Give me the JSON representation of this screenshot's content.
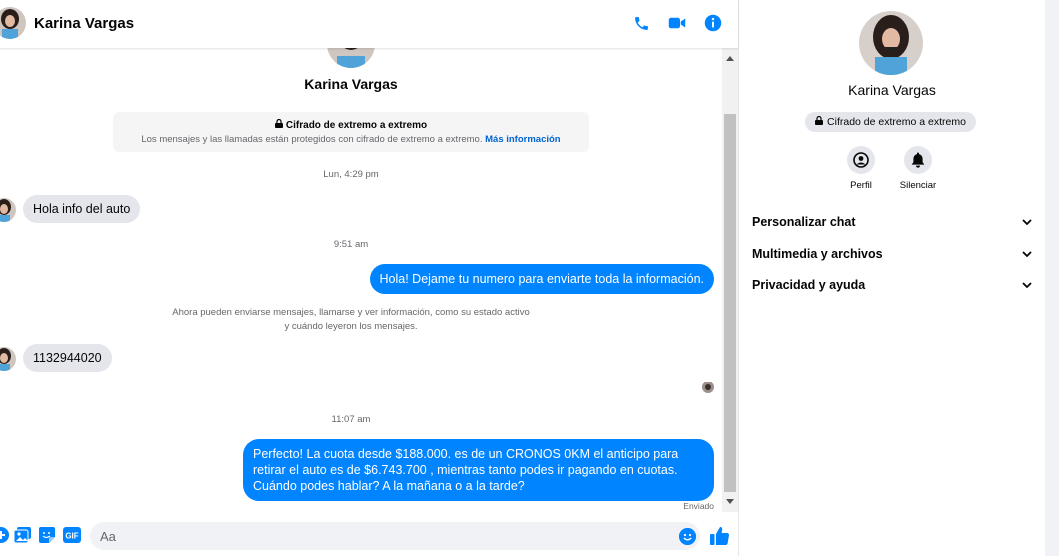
{
  "colors": {
    "accent": "#0084ff",
    "bubble_in": "#e4e6eb",
    "muted_text": "#65676b",
    "link": "#0064d1"
  },
  "header": {
    "contact_name": "Karina Vargas",
    "actions": [
      "phone-icon",
      "video-camera-icon",
      "info-icon"
    ]
  },
  "conversation": {
    "contact_name": "Karina Vargas",
    "e2e_notice": {
      "title": "Cifrado de extremo a extremo",
      "description": "Los mensajes y las llamadas están protegidos con cifrado de extremo a extremo.",
      "link_text": "Más información"
    },
    "timestamps": [
      "Lun, 4:29 pm",
      "9:51 am",
      "11:07 am"
    ],
    "messages": [
      {
        "direction": "in",
        "text": "Hola info del auto"
      },
      {
        "direction": "out",
        "text": "Hola! Dejame tu numero  para enviarte toda la información."
      },
      {
        "direction": "in",
        "text": "1132944020"
      },
      {
        "direction": "out",
        "text": "Perfecto! La cuota desde $188.000. es de un CRONOS 0KM el anticipo para retirar el auto es de $6.743.700 , mientras tanto podes ir pagando en cuotas. Cuándo podes hablar? A la mañana o a la tarde?"
      }
    ],
    "system_note": "Ahora pueden enviarse mensajes, llamarse y ver información, como su estado activo y cuándo leyeron los mensajes.",
    "delivery_status": "Enviado"
  },
  "composer": {
    "placeholder": "Aa",
    "icons": [
      "plus-circle-icon",
      "photo-icon",
      "sticker-icon",
      "gif-icon",
      "emoji-icon",
      "thumbs-up-icon"
    ],
    "gif_label": "GIF"
  },
  "info_panel": {
    "contact_name": "Karina Vargas",
    "encryption_badge": "Cifrado de extremo a extremo",
    "actions": [
      {
        "label": "Perfil",
        "icon": "profile-icon"
      },
      {
        "label": "Silenciar",
        "icon": "bell-icon"
      }
    ],
    "sections": [
      "Personalizar chat",
      "Multimedia y archivos",
      "Privacidad y ayuda"
    ]
  }
}
